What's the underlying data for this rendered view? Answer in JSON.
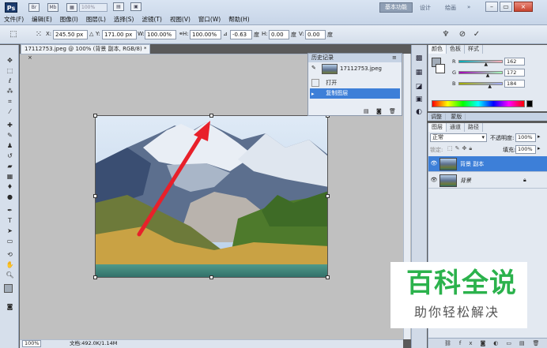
{
  "app": {
    "logo": "Ps",
    "workspace_active": "基本功能",
    "workspace_design": "设计",
    "workspace_painting": "绘画",
    "zoom_select": "100%"
  },
  "menu": [
    "文件(F)",
    "编辑(E)",
    "图像(I)",
    "图层(L)",
    "选择(S)",
    "滤镜(T)",
    "视图(V)",
    "窗口(W)",
    "帮助(H)"
  ],
  "options": {
    "x_label": "X:",
    "x_value": "245.50 px",
    "y_label": "Y:",
    "y_value": "171.00 px",
    "w_label": "W:",
    "w_value": "100.00%",
    "h_label": "H:",
    "h_value": "100.00%",
    "angle_value": "-0.63",
    "angle_unit": "度",
    "hskew_label": "H:",
    "hskew_value": "0.00",
    "hskew_unit": "度",
    "vskew_label": "V:",
    "vskew_value": "0.00",
    "vskew_unit": "度"
  },
  "document": {
    "tab_title": "17112753.jpeg @ 100% (背景 副本, RGB/8) *",
    "close": "×",
    "status_zoom": "100%",
    "status_doc": "文档:492.0K/1.14M"
  },
  "history": {
    "title": "历史记录",
    "snapshot": "17112753.jpeg",
    "items": [
      {
        "label": "打开",
        "selected": false
      },
      {
        "label": "复制图层",
        "selected": true
      }
    ]
  },
  "color_panel": {
    "tabs": [
      "颜色",
      "色板",
      "样式"
    ],
    "r_label": "R",
    "r_value": "162",
    "g_label": "G",
    "g_value": "172",
    "b_label": "B",
    "b_value": "184",
    "r_level": 0.635,
    "g_level": 0.675,
    "b_level": 0.72,
    "swatch_color": "#a2acb8"
  },
  "adjust_tabs": [
    "调整",
    "蒙版"
  ],
  "layers_panel": {
    "tabs": [
      "图层",
      "通道",
      "路径"
    ],
    "blend_mode": "正常",
    "opacity_label": "不透明度:",
    "opacity_value": "100%",
    "lock_label": "锁定:",
    "fill_label": "填充:",
    "fill_value": "100%",
    "layers": [
      {
        "name": "背景 副本",
        "selected": true,
        "locked": false
      },
      {
        "name": "背景",
        "selected": false,
        "locked": true
      }
    ]
  },
  "watermark": {
    "title": "百科全说",
    "subtitle": "助你轻松解决"
  },
  "colors": {
    "accent": "#3d7fd8",
    "arrow": "#e8202a",
    "watermark_green": "#2bb24c"
  },
  "icons": [
    "move-tool-icon",
    "marquee-tool-icon",
    "lasso-tool-icon",
    "magic-wand-icon",
    "crop-tool-icon",
    "eyedropper-icon",
    "brush-icon",
    "eraser-icon",
    "zoom-tool-icon",
    "hand-tool-icon"
  ]
}
